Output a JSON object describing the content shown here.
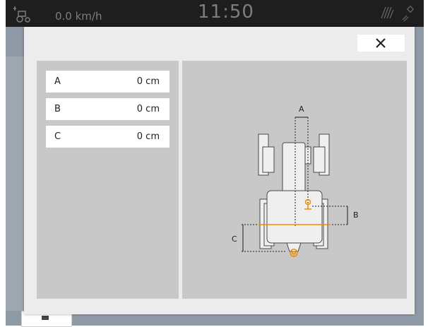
{
  "statusbar": {
    "speed": "0.0 km/h",
    "clock": "11:50",
    "icons": [
      "tractor-icon",
      "field-icon",
      "gps-icon"
    ]
  },
  "dialog": {
    "close_icon": "close-icon",
    "rows": [
      {
        "label": "A",
        "value": "0 cm"
      },
      {
        "label": "B",
        "value": "0 cm"
      },
      {
        "label": "C",
        "value": "0 cm"
      }
    ],
    "diagram_labels": {
      "a": "A",
      "b": "B",
      "c": "C"
    }
  },
  "colors": {
    "accent": "#f08c00",
    "panel": "#c8c8c8",
    "dialog": "#ececec",
    "statusbar": "#1e1e1e"
  }
}
